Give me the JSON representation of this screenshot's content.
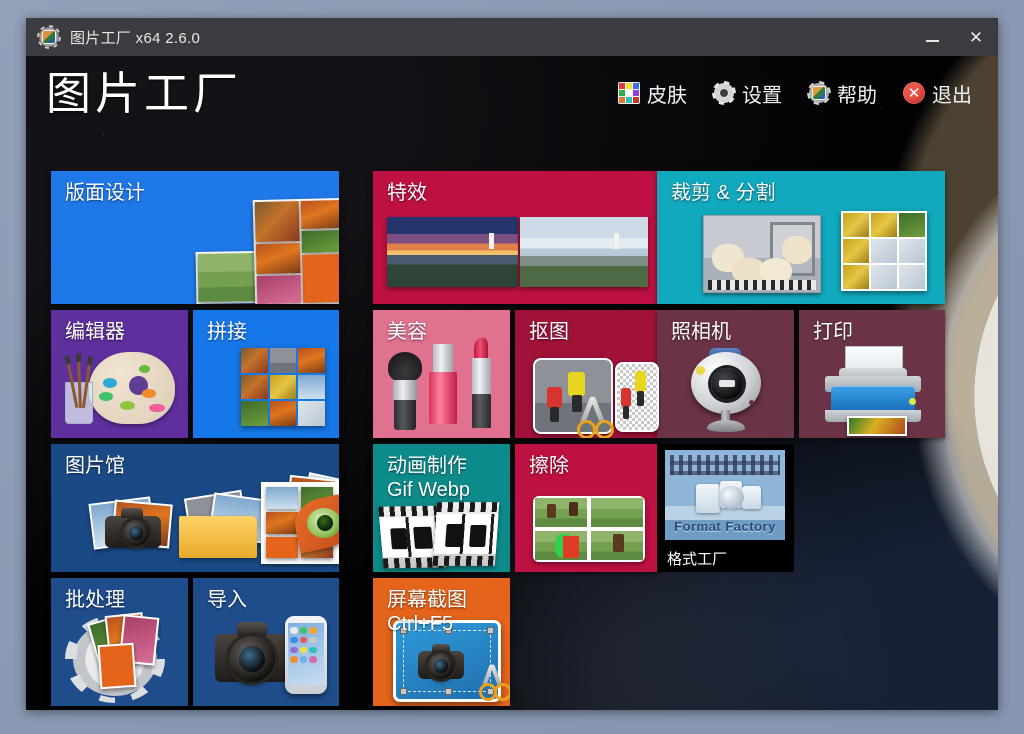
{
  "window": {
    "title": "图片工厂 x64 2.6.0",
    "app_icon": "picture-factory-icon",
    "minimize_label": "",
    "close_label": "✕"
  },
  "header": {
    "brand": "图片工厂",
    "menu": [
      {
        "label": "皮肤",
        "icon": "skin-palette-icon"
      },
      {
        "label": "设置",
        "icon": "gear-icon"
      },
      {
        "label": "帮助",
        "icon": "help-icon"
      },
      {
        "label": "退出",
        "icon": "exit-icon"
      }
    ]
  },
  "colors": {
    "tile_blue": "#1f78e8",
    "tile_purple": "#5f2f9e",
    "tile_bright_blue": "#1677e8",
    "tile_dark_blue": "#1a4a86",
    "tile_steel_blue": "#1f4d8c",
    "tile_crimson": "#bd1141",
    "tile_teal": "#11a9bd",
    "tile_pink": "#e0718f",
    "tile_deep_crimson": "#a01238",
    "tile_maroon": "#6b3346",
    "tile_teal_dark": "#0d8b8b",
    "tile_orange": "#e4641b",
    "tile_black": "#000000",
    "titlebar": "#3a3c40",
    "desktop": "#8a9ab4"
  },
  "tiles": [
    {
      "id": "layout-design",
      "label": "版面设计",
      "art": "collage",
      "color": "#1f78e8"
    },
    {
      "id": "editor",
      "label": "编辑器",
      "art": "palette",
      "color": "#5f2f9e"
    },
    {
      "id": "stitch",
      "label": "拼接",
      "art": "grid9",
      "color": "#1677e8"
    },
    {
      "id": "gallery",
      "label": "图片馆",
      "art": "photos-eye",
      "color": "#1a4a86"
    },
    {
      "id": "batch-process",
      "label": "批处理",
      "art": "gear-photos",
      "color": "#1f4d8c"
    },
    {
      "id": "import",
      "label": "导入",
      "art": "dslr-phone",
      "color": "#1f4d8c"
    },
    {
      "id": "effects",
      "label": "特效",
      "art": "two-scenes",
      "color": "#bd1141"
    },
    {
      "id": "beauty",
      "label": "美容",
      "art": "cosmetics",
      "color": "#e0718f"
    },
    {
      "id": "cutout",
      "label": "抠图",
      "art": "cutout",
      "color": "#a01238"
    },
    {
      "id": "animation",
      "label": "动画制作\nGif Webp",
      "art": "filmstrip",
      "color": "#0d8b8b"
    },
    {
      "id": "erase",
      "label": "擦除",
      "art": "erase",
      "color": "#bd1141"
    },
    {
      "id": "screenshot",
      "label": "屏幕截图\nCtrl+F5",
      "art": "screenshot",
      "color": "#e4641b"
    },
    {
      "id": "crop-split",
      "label": "裁剪 & 分割",
      "art": "crop-split",
      "color": "#11a9bd"
    },
    {
      "id": "camera",
      "label": "照相机",
      "art": "webcam",
      "color": "#6b3346"
    },
    {
      "id": "print",
      "label": "打印",
      "art": "printer",
      "color": "#6b3346"
    },
    {
      "id": "format-factory",
      "label": "",
      "art": "promo",
      "color": "#000000"
    }
  ],
  "promo": {
    "brand_text": "Format Factory",
    "caption": "格式工厂"
  }
}
